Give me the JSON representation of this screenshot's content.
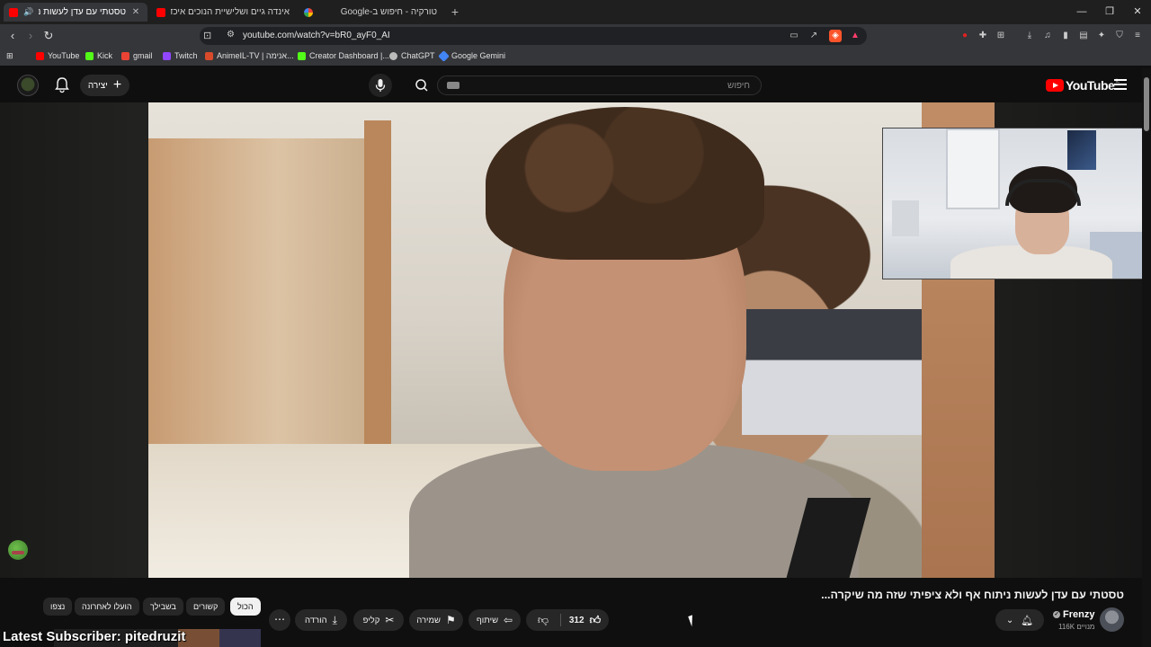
{
  "browser": {
    "tabs": [
      {
        "title": "טסטתי עם עדן לעשות ניתוח אף",
        "active": true,
        "audio": true
      },
      {
        "title": "אינדה גיים ושלישיית הנוכים איכדו את",
        "active": false
      },
      {
        "title": "טורקיה - חיפוש ב-Google",
        "active": false
      }
    ],
    "new_tab": "+",
    "url": "youtube.com/watch?v=bR0_ayF0_AI",
    "bookmarks": [
      {
        "label": "YouTube",
        "color": "#ff0000"
      },
      {
        "label": "Kick",
        "color": "#53fc18"
      },
      {
        "label": "gmail",
        "color": "#ea4335"
      },
      {
        "label": "Twitch",
        "color": "#9146ff"
      },
      {
        "label": "AnimeIL-TV | אנימה...",
        "color": "#d84a2a"
      },
      {
        "label": "Creator Dashboard |...",
        "color": "#53fc18"
      },
      {
        "label": "ChatGPT",
        "color": "#bbbbbb"
      },
      {
        "label": "Google Gemini",
        "color": "#4285f4"
      }
    ]
  },
  "youtube": {
    "logo_text": "YouTube",
    "logo_cc": "IL",
    "search_placeholder": "חיפוש",
    "create_label": "יצירה"
  },
  "video": {
    "title": "טסטתי עם עדן לעשות ניתוח אף ולא ציפיתי שזה מה שיקרה..."
  },
  "channel": {
    "name": "Frenzy",
    "subscribers": "116K מנויים"
  },
  "actions": {
    "like_count": "312",
    "share": "שיתוף",
    "save": "שמירה",
    "clip": "קליפ",
    "download": "הורדה"
  },
  "chips": [
    "הכול",
    "קשורים",
    "בשבילך",
    "הועלו לאחרונה",
    "נצפו"
  ],
  "overlay": {
    "latest_subscriber": "Latest Subscriber: pitedruzit"
  }
}
